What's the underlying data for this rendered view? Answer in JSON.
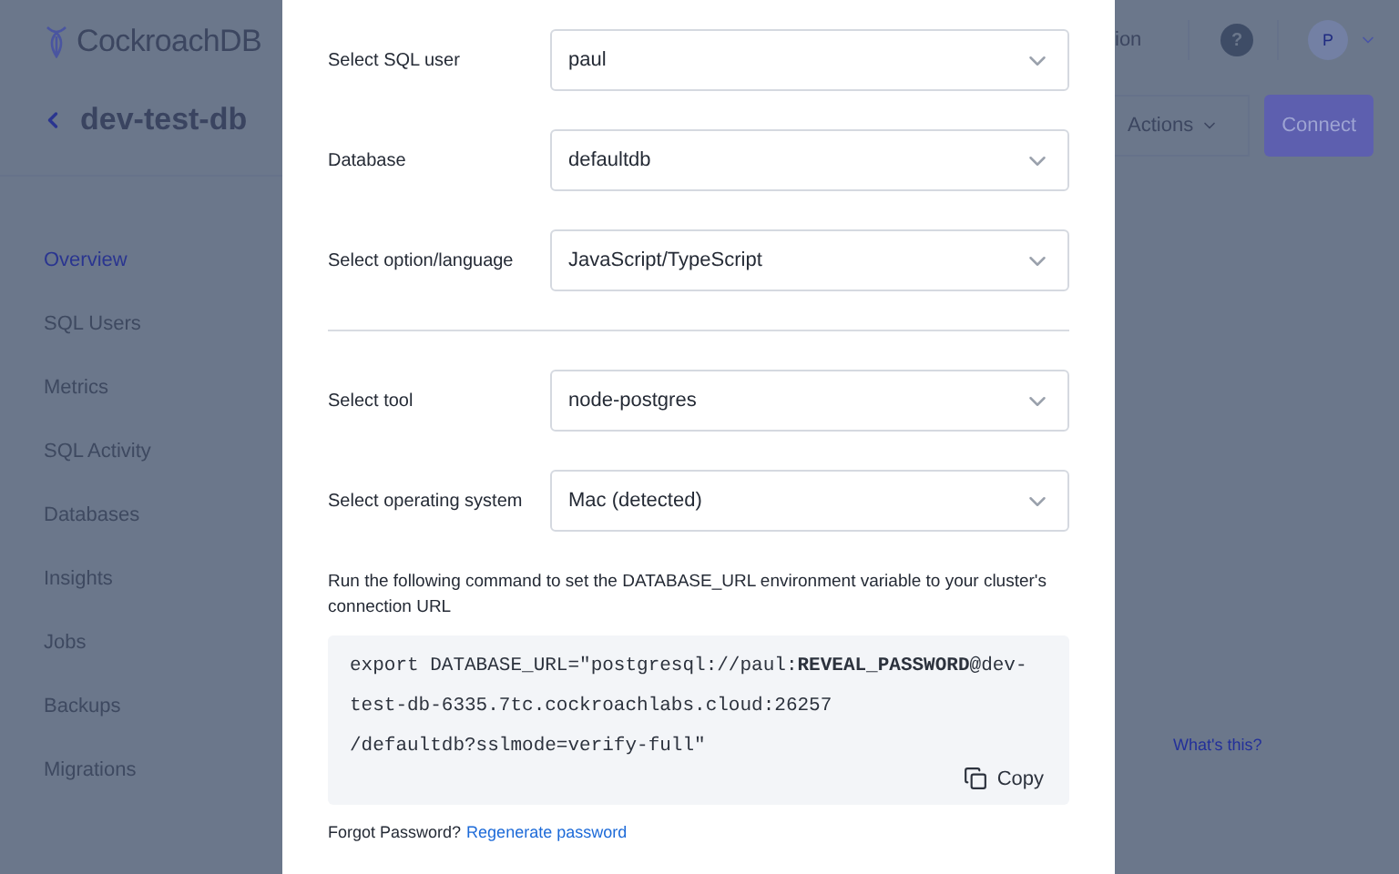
{
  "sidebar": {
    "logo": "CockroachDB",
    "cluster": "dev-test-db",
    "items": [
      {
        "label": "Overview",
        "selected": true
      },
      {
        "label": "SQL Users",
        "selected": false
      },
      {
        "label": "Metrics",
        "selected": false
      },
      {
        "label": "SQL Activity",
        "selected": false
      },
      {
        "label": "Databases",
        "selected": false
      },
      {
        "label": "Insights",
        "selected": false
      },
      {
        "label": "Jobs",
        "selected": false
      },
      {
        "label": "Backups",
        "selected": false
      },
      {
        "label": "Migrations",
        "selected": false
      }
    ]
  },
  "header": {
    "partial_text": "ion",
    "help": "?",
    "avatar": "P",
    "actions": "Actions",
    "connect": "Connect",
    "link": "What's this?"
  },
  "modal": {
    "fields": [
      {
        "label": "Select SQL user",
        "value": "paul"
      },
      {
        "label": "Database",
        "value": "defaultdb"
      },
      {
        "label": "Select option/language",
        "value": "JavaScript/TypeScript"
      },
      {
        "label": "Select tool",
        "value": "node-postgres",
        "divider_before": true
      },
      {
        "label": "Select operating system",
        "value": "Mac (detected)"
      }
    ],
    "instruction": "Run the following command to set the DATABASE_URL environment variable to your cluster's connection URL",
    "command": [
      "export DATABASE_URL=\"postgresql://paul:**REVEAL_PASSWORD**@dev-",
      "test-db-6335.7tc.cockroachlabs.cloud:26257",
      "/defaultdb?sslmode=verify-full\""
    ],
    "copy": "Copy",
    "forgot": "Forgot Password?",
    "regenerate": "Regenerate password"
  }
}
